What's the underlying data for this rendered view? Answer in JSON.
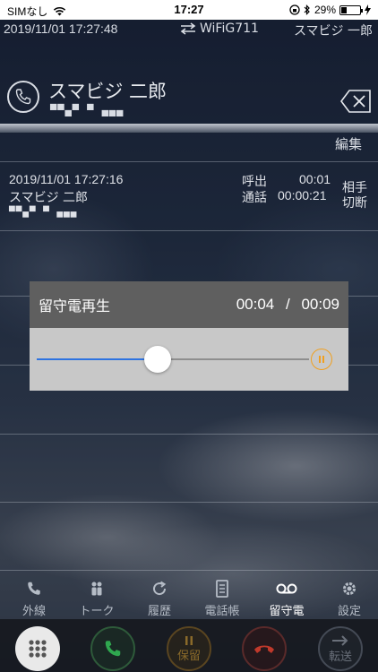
{
  "status_bar": {
    "carrier": "SIMなし",
    "time": "17:27",
    "battery": "29%",
    "battery_level": 0.29
  },
  "header": {
    "timestamp": "2019/11/01 17:27:48",
    "device": "WiFiG711",
    "user": "スマビジ 一郎"
  },
  "contact": {
    "name": "スマビジ 二郎",
    "number": "▀▀▄▀ ▀ ▄▄▄"
  },
  "edit_label": "編集",
  "history": {
    "datetime": "2019/11/01 17:27:16",
    "name": "スマビジ 二郎",
    "number": "▀▀▄▀ ▀ ▄▄▄",
    "ring_label": "呼出",
    "ring_time": "00:01",
    "talk_label": "通話",
    "talk_time": "00:00:21",
    "end_reason_line1": "相手",
    "end_reason_line2": "切断"
  },
  "voicemail": {
    "title": "留守電再生",
    "elapsed": "00:04",
    "separator": "/",
    "total": "00:09",
    "progress": 0.444
  },
  "tabs": [
    {
      "label": "外線",
      "icon": "phone-icon"
    },
    {
      "label": "トーク",
      "icon": "talk-icon"
    },
    {
      "label": "履歴",
      "icon": "history-icon"
    },
    {
      "label": "電話帳",
      "icon": "phonebook-icon"
    },
    {
      "label": "留守電",
      "icon": "voicemail-icon"
    },
    {
      "label": "設定",
      "icon": "gear-icon"
    }
  ],
  "controls": {
    "hold": "保留",
    "transfer": "転送"
  },
  "colors": {
    "accent_blue": "#2e73e0",
    "pause_orange": "#f0a020",
    "call_green": "#2fa84f",
    "hangup_red": "#c0392b"
  }
}
